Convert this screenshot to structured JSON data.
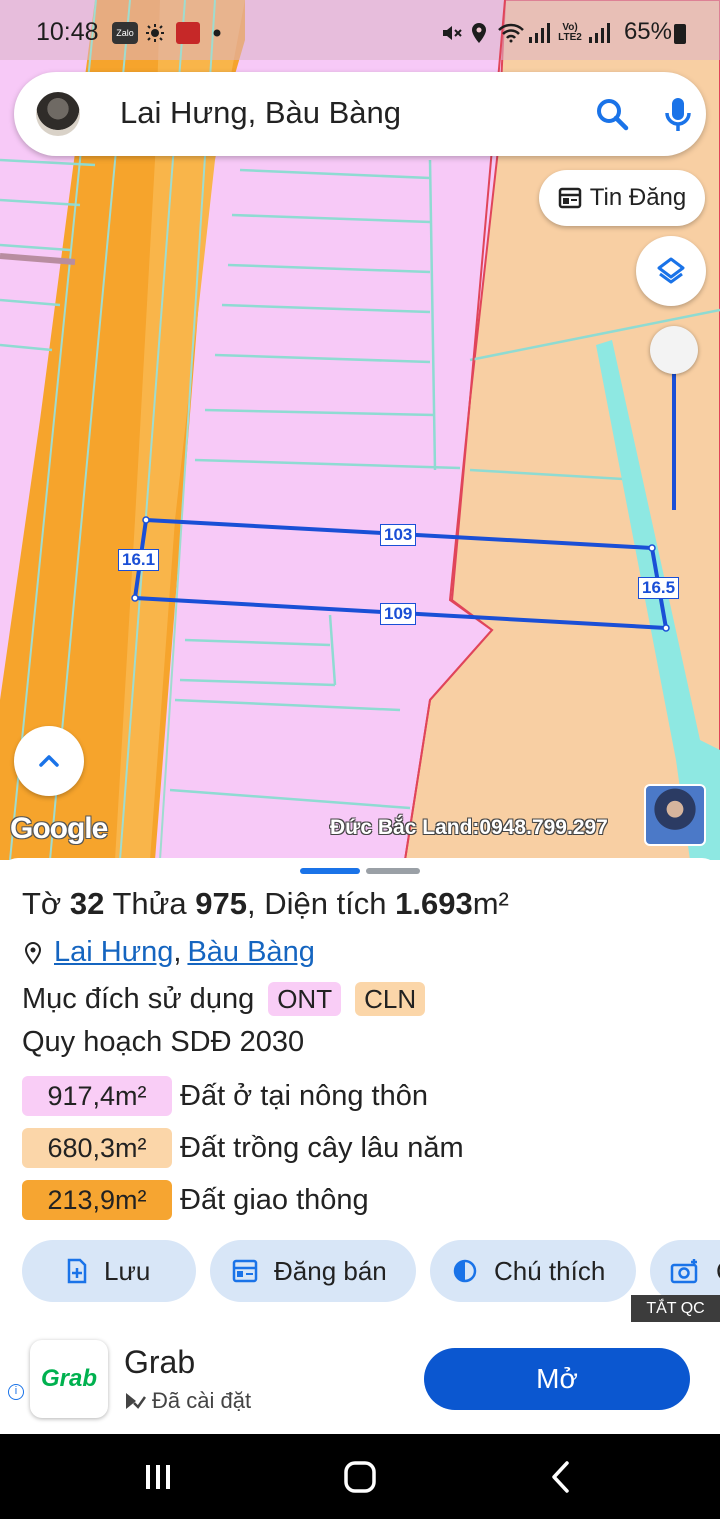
{
  "status_bar": {
    "time": "10:48",
    "zalo": "Zalo",
    "network": "Vo) LTE2",
    "battery": "65%"
  },
  "search": {
    "query": "Lai Hưng, Bàu Bàng"
  },
  "map": {
    "tin_dang_label": "Tin Đăng",
    "dims": {
      "left": "16.1",
      "top": "103",
      "bottom": "109",
      "right": "16.5"
    },
    "google_logo": "Google",
    "watermark": "Đức Bắc Land:0948.799.297"
  },
  "sheet": {
    "title_prefix": "Tờ",
    "sheet_no": "32",
    "parcel_label": "Thửa",
    "parcel_no": "975",
    "area_label": ", Diện tích",
    "area_value": "1.693",
    "area_unit": "m²",
    "location_commune": "Lai Hưng",
    "location_sep": ",",
    "location_district": "Bàu Bàng",
    "purpose_label": "Mục đích sử dụng",
    "purpose_tags": [
      "ONT",
      "CLN"
    ],
    "plan_label": "Quy hoạch SDĐ 2030",
    "plan_rows": [
      {
        "area": "917,4m²",
        "label": "Đất ở tại nông thôn",
        "color": "#f9cdf6"
      },
      {
        "area": "680,3m²",
        "label": "Đất trồng cây lâu năm",
        "color": "#fbd6a9"
      },
      {
        "area": "213,9m²",
        "label": "Đất giao thông",
        "color": "#f6a531"
      }
    ],
    "actions": [
      "Lưu",
      "Đăng bán",
      "Chú thích",
      "C"
    ]
  },
  "ad_label": "TẮT QC",
  "ad": {
    "logo_text": "Grab",
    "name": "Grab",
    "status": "Đã cài đặt",
    "open_label": "Mở"
  },
  "colors": {
    "residential": "#f7c9f7",
    "perennial": "#f8cfa3",
    "road": "#f6a42c",
    "canal": "#8ee8e2",
    "parcel_line": "#1a4fd6",
    "accent": "#1a73e8"
  }
}
